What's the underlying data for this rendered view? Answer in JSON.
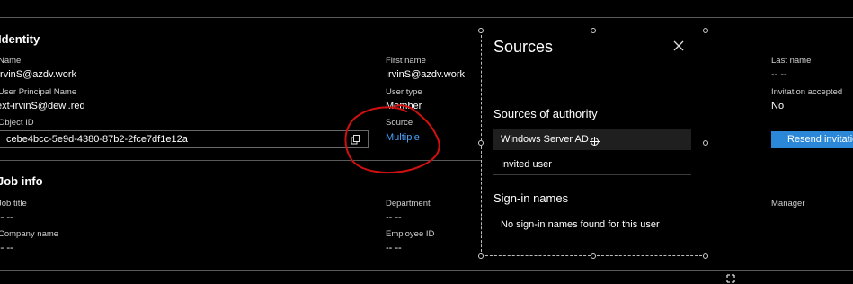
{
  "identity": {
    "title": "Identity",
    "name_label": "Name",
    "name_value": "IrvinS@azdv.work",
    "upn_label": "User Principal Name",
    "upn_value": "ext-irvinS@dewi.red",
    "objectid_label": "Object ID",
    "objectid_value": "cebe4bcc-5e9d-4380-87b2-2fce7df1e12a",
    "firstname_label": "First name",
    "firstname_value": "IrvinS@azdv.work",
    "usertype_label": "User type",
    "usertype_value": "Member",
    "source_label": "Source",
    "source_value": "Multiple",
    "lastname_label": "Last name",
    "lastname_value": "-- --",
    "invitation_label": "Invitation accepted",
    "invitation_value": "No",
    "resend_label": "Resend invitation"
  },
  "job": {
    "title": "Job info",
    "jobtitle_label": "Job title",
    "jobtitle_value": "-- --",
    "department_label": "Department",
    "department_value": "-- --",
    "company_label": "Company name",
    "company_value": "-- --",
    "employee_label": "Employee ID",
    "employee_value": "-- --",
    "manager_label": "Manager"
  },
  "sources_panel": {
    "title": "Sources",
    "authority_heading": "Sources of authority",
    "authority_items": [
      "Windows Server AD",
      "Invited user"
    ],
    "signin_heading": "Sign-in names",
    "signin_empty": "No sign-in names found for this user"
  },
  "colors": {
    "link": "#4aa3ff",
    "button": "#2b88d8",
    "annotation": "#d01010",
    "row_selected": "#1f1f1f"
  },
  "icons": [
    "copy-icon",
    "close-icon",
    "cursor-crosshair-icon",
    "resize-icon"
  ]
}
